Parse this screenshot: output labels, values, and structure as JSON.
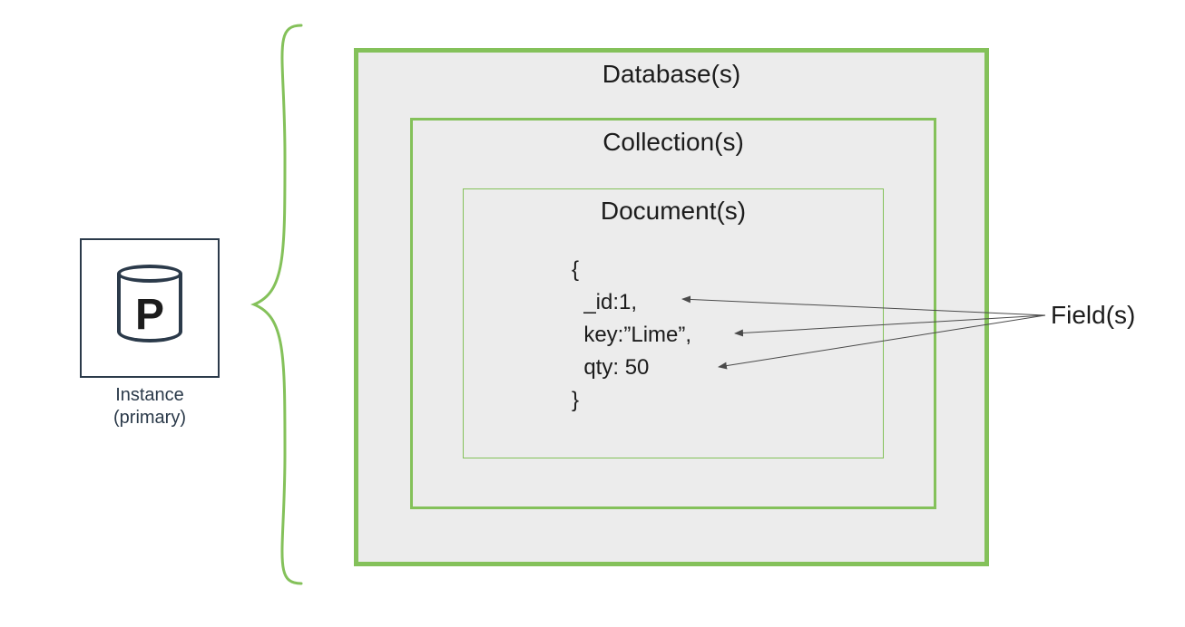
{
  "instance": {
    "letter": "P",
    "label_line1": "Instance",
    "label_line2": "(primary)"
  },
  "boxes": {
    "database": "Database(s)",
    "collection": "Collection(s)",
    "document": "Document(s)"
  },
  "document_example": {
    "open": "{",
    "line1": "  _id:1,",
    "line2": "  key:”Lime”,",
    "line3": "  qty: 50",
    "close": "}"
  },
  "fields_label": "Field(s)",
  "colors": {
    "box_border": "#84c15a",
    "box_fill": "#ececec",
    "ink": "#1c1c1c",
    "instance_stroke": "#2b3a4a"
  }
}
